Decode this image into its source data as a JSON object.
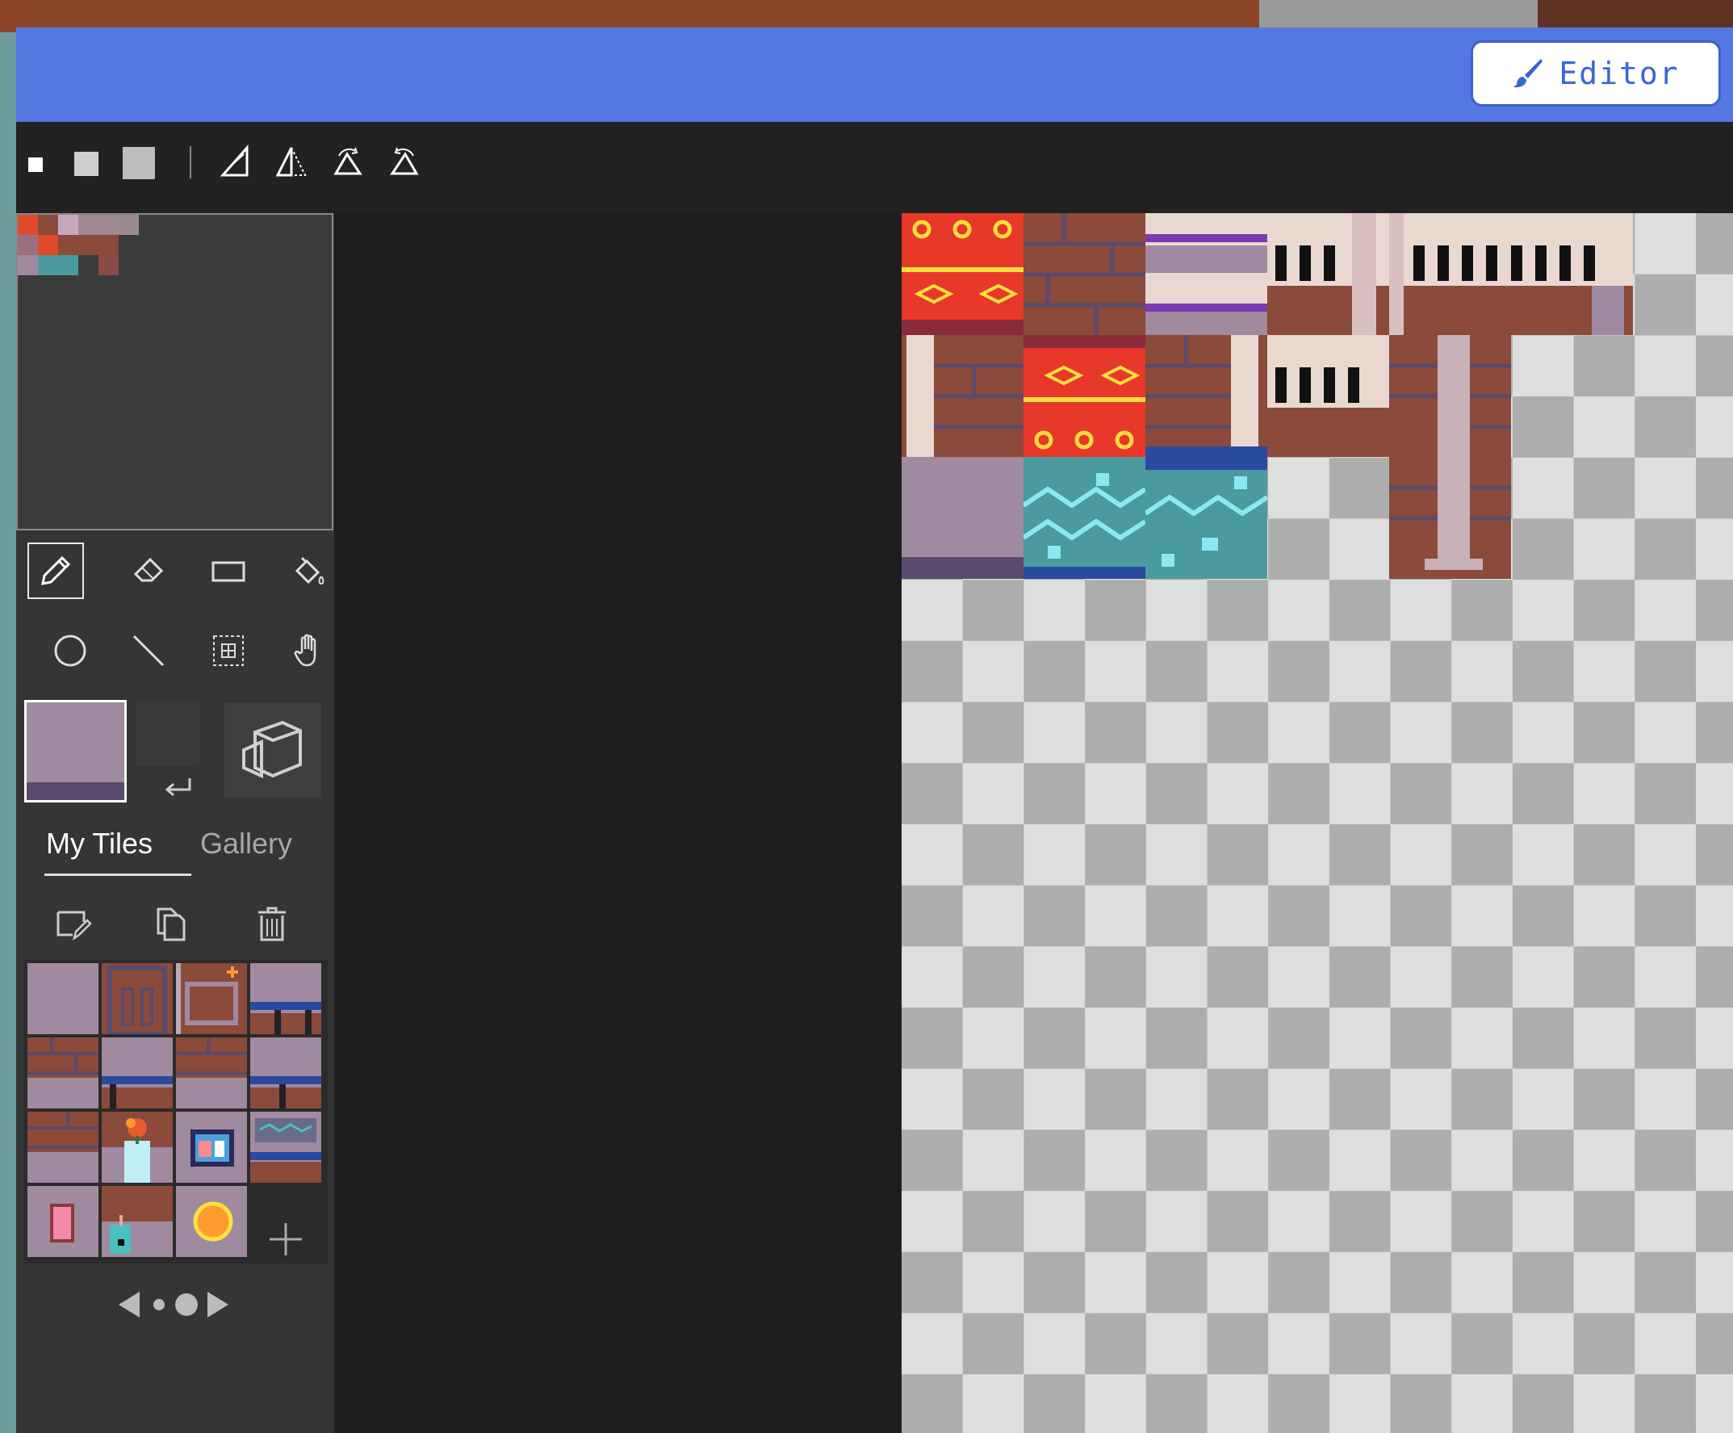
{
  "header": {
    "editor_button_label": "Editor"
  },
  "tabs": [
    {
      "label": "My Tiles",
      "active": true
    },
    {
      "label": "Gallery",
      "active": false
    }
  ],
  "palette": {
    "primary": "#9f8aa0",
    "primary_band": "#5a4a6e"
  },
  "colors": {
    "header": "#5478e2",
    "editor_text": "#3b63d9",
    "sidebar": "#353535",
    "canvas_light": "#dedede",
    "canvas_dark": "#adadad"
  },
  "icons": {
    "toolbar": [
      "brush-size-small-icon",
      "brush-size-medium-icon",
      "brush-size-large-icon",
      "flip-horizontal-icon",
      "flip-vertical-icon",
      "rotate-clockwise-icon",
      "rotate-counterclockwise-icon"
    ],
    "tools": [
      "pencil-icon",
      "eraser-icon",
      "rectangle-icon",
      "fill-icon",
      "circle-icon",
      "line-icon",
      "marquee-icon",
      "pan-icon"
    ],
    "tile_actions": [
      "edit-tile-icon",
      "duplicate-tile-icon",
      "delete-tile-icon"
    ]
  },
  "pager": {
    "pages": 2,
    "current": 2
  }
}
